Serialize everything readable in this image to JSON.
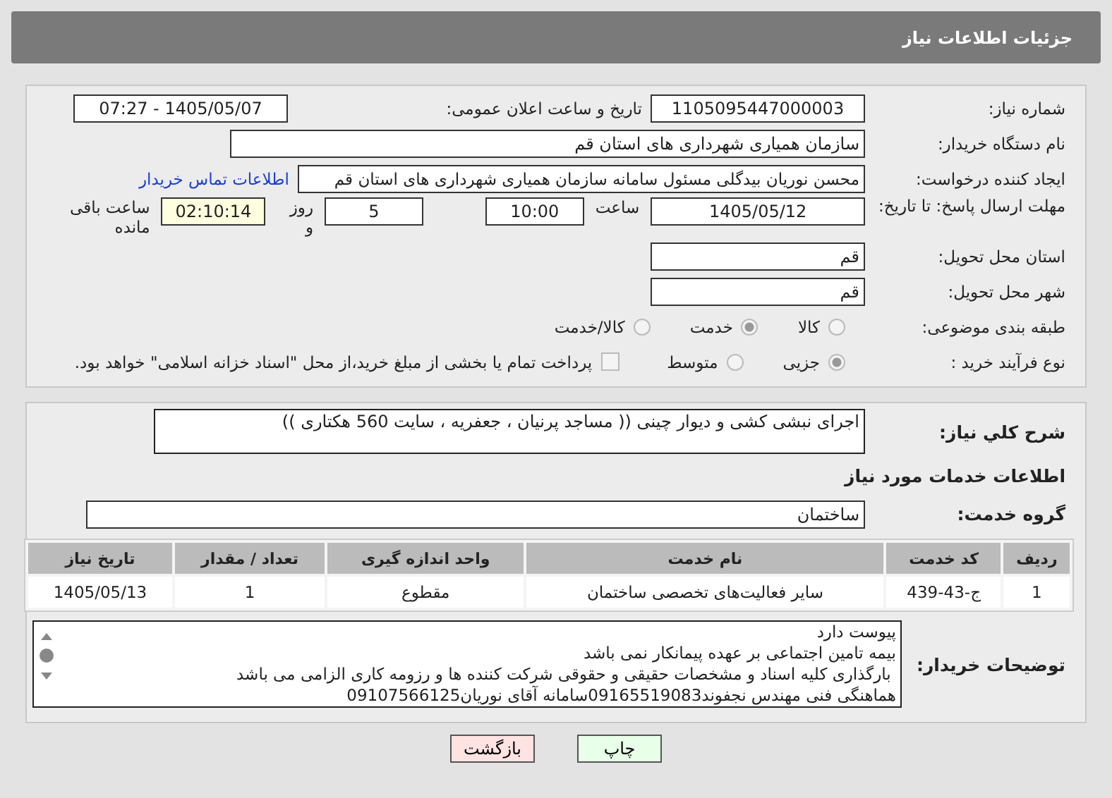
{
  "header": {
    "title": "جزئیات اطلاعات نیاز"
  },
  "form": {
    "need_number_label": "شماره نیاز:",
    "need_number": "1105095447000003",
    "announce_label": "تاریخ و ساعت اعلان عمومی:",
    "announce_value": "1405/05/07 - 07:27",
    "buyer_label": "نام دستگاه خریدار:",
    "buyer": "سازمان همیاری شهرداری های استان قم",
    "creator_label": "ایجاد کننده درخواست:",
    "creator": "محسن نوریان بیدگلی مسئول سامانه سازمان همیاری شهرداری های استان قم",
    "contact_link": "اطلاعات تماس خریدار",
    "deadline_label": "مهلت ارسال پاسخ: تا تاریخ:",
    "deadline_date": "1405/05/12",
    "time_label": "ساعت",
    "deadline_time": "10:00",
    "days": "5",
    "days_label": "روز و",
    "remaining": "02:10:14",
    "remaining_label": "ساعت باقی مانده",
    "province_label": "استان محل تحویل:",
    "province": "قم",
    "city_label": "شهر محل تحویل:",
    "city": "قم",
    "category_label": "طبقه بندی موضوعی:",
    "category_options": [
      {
        "label": "کالا",
        "selected": false
      },
      {
        "label": "خدمت",
        "selected": true
      },
      {
        "label": "کالا/خدمت",
        "selected": false
      }
    ],
    "process_label": "نوع فرآیند خرید :",
    "process_options": [
      {
        "label": "جزیی",
        "selected": true
      },
      {
        "label": "متوسط",
        "selected": false
      }
    ],
    "payment_checkbox": {
      "label": "پرداخت تمام یا بخشی از مبلغ خرید،از محل \"اسناد خزانه اسلامی\" خواهد بود.",
      "checked": false
    }
  },
  "details": {
    "description_label": "شرح کلي نياز:",
    "description": "اجرای نبشی کشی و دیوار چینی (( مساجد پرنیان ، جعفریه ، سایت 560 هکتاری ))",
    "services_heading": "اطلاعات خدمات مورد نیاز",
    "group_label": "گروه خدمت:",
    "group": "ساختمان",
    "table": {
      "columns": [
        "ردیف",
        "کد خدمت",
        "نام خدمت",
        "واحد اندازه گیری",
        "تعداد / مقدار",
        "تاریخ نیاز"
      ],
      "rows": [
        [
          "1",
          "ج-43-439",
          "سایر فعالیت‌های تخصصی ساختمان",
          "مقطوع",
          "1",
          "1405/05/13"
        ]
      ]
    },
    "notes_label": "توضیحات خریدار:",
    "notes": [
      "پیوست دارد",
      "بیمه تامین اجتماعی بر عهده پیمانکار نمی باشد",
      " بارگذاری کلیه اسناد و مشخصات حقیقی و حقوقی شرکت کننده ها و رزومه کاری الزامی می باشد",
      "هماهنگی فنی مهندس نجفوند09165519083سامانه آقای نوریان09107566125"
    ]
  },
  "buttons": {
    "print": "چاپ",
    "back": "بازگشت"
  }
}
